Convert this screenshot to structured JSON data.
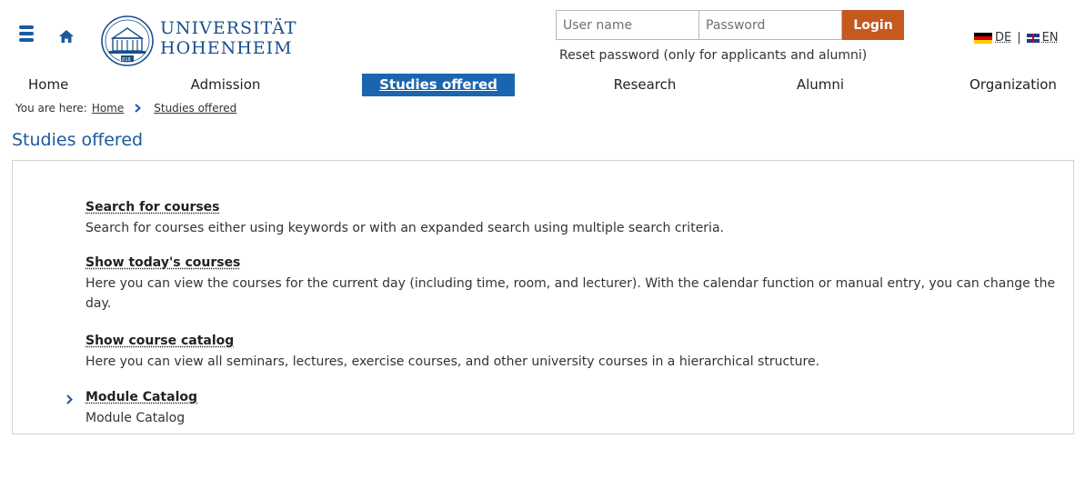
{
  "header": {
    "logo_line1": "UNIVERSITÄT",
    "logo_line2": "HOHENHEIM",
    "logo_year": "1818",
    "login": {
      "username_placeholder": "User name",
      "password_placeholder": "Password",
      "button_label": "Login",
      "reset_link": "Reset password (only for applicants and alumni)"
    },
    "languages": {
      "de": "DE",
      "separator": "|",
      "en": "EN"
    }
  },
  "nav": {
    "items": [
      {
        "label": "Home",
        "active": false
      },
      {
        "label": "Admission",
        "active": false
      },
      {
        "label": "Studies offered",
        "active": true
      },
      {
        "label": "Research",
        "active": false
      },
      {
        "label": "Alumni",
        "active": false
      },
      {
        "label": "Organization",
        "active": false
      }
    ]
  },
  "breadcrumb": {
    "prefix": "You are here:",
    "items": [
      "Home",
      "Studies offered"
    ]
  },
  "page_title": "Studies offered",
  "content": {
    "entries": [
      {
        "title": "Search for courses",
        "description": "Search for courses either using keywords or with an expanded search using multiple search criteria."
      },
      {
        "title": "Show today's courses",
        "description": "Here you can view the courses for the current day (including time, room, and lecturer). With the calendar function or manual entry, you can change the day."
      },
      {
        "title": "Show course catalog",
        "description": "Here you can view all seminars, lectures, exercise courses, and other university courses in a hierarchical structure."
      },
      {
        "title": "Module Catalog",
        "description": "Module Catalog"
      }
    ]
  },
  "colors": {
    "brand_blue": "#1a5aa0",
    "nav_active": "#1a65b0",
    "login_orange": "#c65a1e",
    "page_background": "#f0f0f0"
  },
  "icons": {
    "menu": "hamburger-icon",
    "home": "home-icon",
    "breadcrumb_separator": "chevron-right-icon",
    "expand_entry": "chevron-right-icon"
  }
}
